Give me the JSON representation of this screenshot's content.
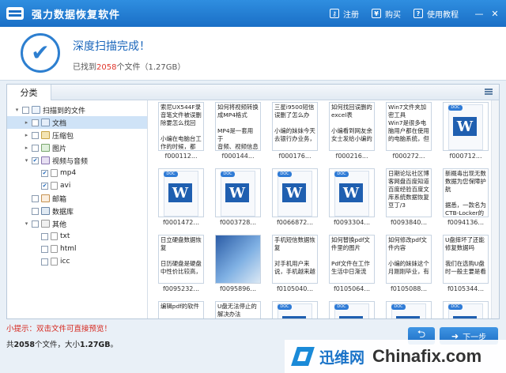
{
  "app": {
    "title": "强力数据恢复软件",
    "register": "注册",
    "buy": "购买",
    "help": "使用教程",
    "minimize": "—",
    "close": "✕"
  },
  "summary": {
    "title": "深度扫描完成！",
    "found_prefix": "已找到",
    "found_count": "2058",
    "found_suffix": "个文件（1.27GB）"
  },
  "panel": {
    "tab_label": "分类"
  },
  "tree": [
    {
      "label": "扫描到的文件",
      "level": 0,
      "expander": "▾",
      "icon": "folder",
      "checked": false,
      "selected": false
    },
    {
      "label": "文档",
      "level": 1,
      "expander": "▸",
      "icon": "doc",
      "checked": false,
      "selected": true
    },
    {
      "label": "压缩包",
      "level": 1,
      "expander": "▸",
      "icon": "zip",
      "checked": false,
      "selected": false
    },
    {
      "label": "图片",
      "level": 1,
      "expander": "▸",
      "icon": "img",
      "checked": false,
      "selected": false
    },
    {
      "label": "视频与音频",
      "level": 1,
      "expander": "▾",
      "icon": "vid",
      "checked": true,
      "selected": false
    },
    {
      "label": "mp4",
      "level": 2,
      "expander": "",
      "icon": "file",
      "checked": true,
      "selected": false
    },
    {
      "label": "avi",
      "level": 2,
      "expander": "",
      "icon": "file",
      "checked": true,
      "selected": false
    },
    {
      "label": "邮箱",
      "level": 1,
      "expander": "",
      "icon": "mail",
      "checked": false,
      "selected": false
    },
    {
      "label": "数据库",
      "level": 1,
      "expander": "",
      "icon": "db",
      "checked": false,
      "selected": false
    },
    {
      "label": "其他",
      "level": 1,
      "expander": "▾",
      "icon": "oth",
      "checked": false,
      "selected": false
    },
    {
      "label": "txt",
      "level": 2,
      "expander": "",
      "icon": "file",
      "checked": false,
      "selected": false
    },
    {
      "label": "html",
      "level": 2,
      "expander": "",
      "icon": "file",
      "checked": false,
      "selected": false
    },
    {
      "label": "icc",
      "level": 2,
      "expander": "",
      "icon": "file",
      "checked": false,
      "selected": false
    }
  ],
  "files": [
    {
      "name": "f000112...",
      "kind": "text",
      "text": "索尼UX544F录\n音笔文件被误删\n除要怎么找回\n\n小编在电脑台工\n作的时候，都\n"
    },
    {
      "name": "f000144...",
      "kind": "text",
      "text": "如何将视频转换\n成MP4格式\n\nMP4是一套用于\n音频、视频信息\n的压缩编码标准"
    },
    {
      "name": "f000176...",
      "kind": "text",
      "text": "三星i9500短信\n误删了怎么办\n\n小编的妹妹今天\n去银行办业务，\n"
    },
    {
      "name": "f000216...",
      "kind": "text",
      "text": "如何找回误删的\nexcel表\n\n小编看到网友余\n女士发给小编的\n"
    },
    {
      "name": "f000272...",
      "kind": "text",
      "text": "Win7文件夹加\n密工具\nWin7是很多电\n脑用户都在使用\n的电脑系统，但\n"
    },
    {
      "name": "f000712...",
      "kind": "word"
    },
    {
      "name": "f0001472...",
      "kind": "word"
    },
    {
      "name": "f0003728...",
      "kind": "word"
    },
    {
      "name": "f0066872...",
      "kind": "word"
    },
    {
      "name": "f0093304...",
      "kind": "word"
    },
    {
      "name": "f0093840...",
      "kind": "text",
      "text": "日期论坛社区博\n客网盘百度知道\n百度经验百度文\n库系统数据恢复\n豆丁/3\n"
    },
    {
      "name": "f0094136...",
      "kind": "text",
      "text": "新概毒出现无数\n数据为您保障护\n航\n\n据悉，一款名为\nCTB-Locker的"
    },
    {
      "name": "f0095232...",
      "kind": "text",
      "text": "日立硬盘数据恢\n复\n\n日历硬盘是硬盘\n中性价比较高，\n"
    },
    {
      "name": "f0095896...",
      "kind": "photo"
    },
    {
      "name": "f0105040...",
      "kind": "text",
      "text": "手机短信数据恢\n复\n\n对手机用户来\n说，手机越来越\n"
    },
    {
      "name": "f0105064...",
      "kind": "text",
      "text": "如何替换pdf文\n件里的图片\n\nPdf文件在工作\n生活中日渐流\n"
    },
    {
      "name": "f0105088...",
      "kind": "text",
      "text": "如何修改pdf文\n件内容\n\n小编的妹妹这个\n月刚刚毕业，有\n"
    },
    {
      "name": "f0105344...",
      "kind": "text",
      "text": "U盘摔坏了还能\n修复数据吗\n\n我们在选购U盘\n时一般主要是看\n"
    },
    {
      "name": "",
      "kind": "text",
      "text": "编辑pdf的软件\n"
    },
    {
      "name": "",
      "kind": "text",
      "text": "U盘无法停止的\n解决办法\n"
    },
    {
      "name": "",
      "kind": "word"
    },
    {
      "name": "",
      "kind": "word"
    },
    {
      "name": "",
      "kind": "word"
    },
    {
      "name": "",
      "kind": "word"
    }
  ],
  "footer": {
    "hint": "小提示：双击文件可直接预览！",
    "totals_prefix": "共",
    "totals_count": "2058",
    "totals_middle": "个文件，大小",
    "totals_size": "1.27GB",
    "totals_suffix": "。",
    "back_symbol": "⮌",
    "next_label": "下一步",
    "next_symbol": "➜"
  },
  "watermark": {
    "cn": "迅维网",
    "en": "Chinafix.com"
  },
  "colors": {
    "titlebar": "#1a6fc6",
    "accent": "#2d7fd0",
    "count_red": "#e0352b",
    "hint_red": "#d6281f"
  }
}
